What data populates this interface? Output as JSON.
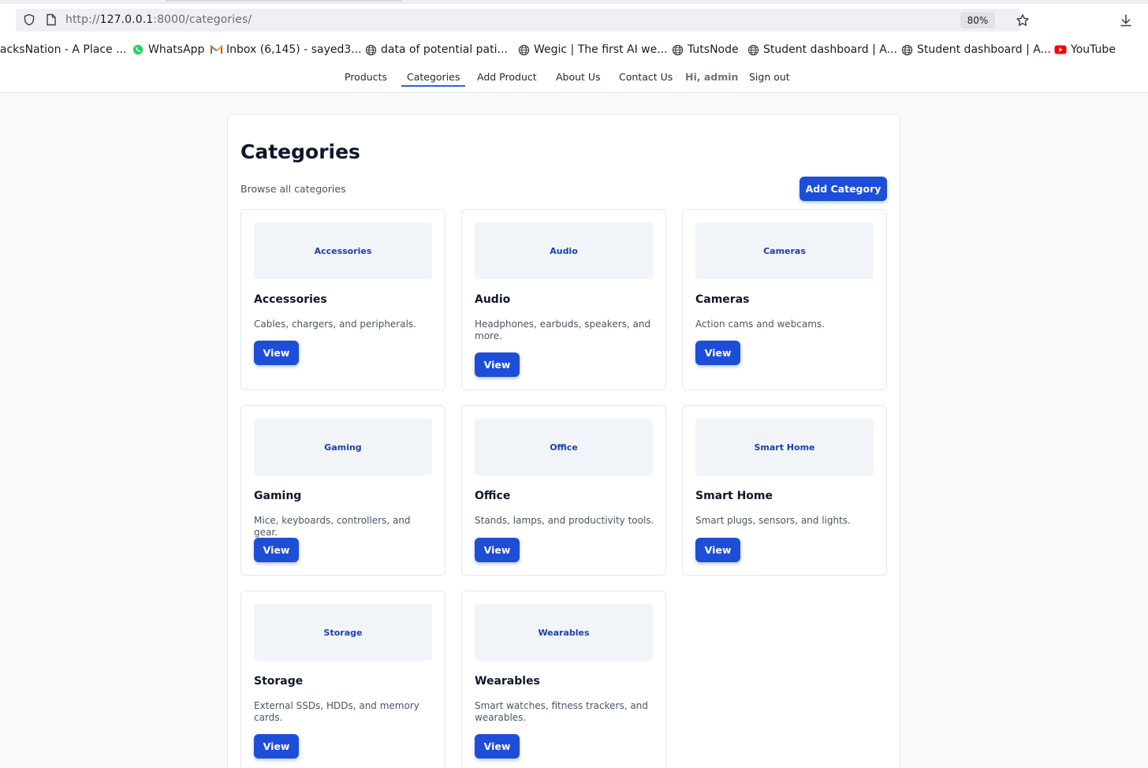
{
  "browser": {
    "url_prefix": "http://",
    "url_host": "127.0.0.1",
    "url_rest": ":8000/categories/",
    "zoom": "80%",
    "bookmarks": [
      {
        "label": "lacksNation - A Place ...",
        "icon": "none"
      },
      {
        "label": "WhatsApp",
        "icon": "whatsapp-icon"
      },
      {
        "label": "Inbox (6,145) - sayed3...",
        "icon": "gmail-icon"
      },
      {
        "label": "data of potential pati...",
        "icon": "globe-icon"
      },
      {
        "label": "Wegic | The first AI we...",
        "icon": "globe-icon"
      },
      {
        "label": "TutsNode",
        "icon": "globe-icon"
      },
      {
        "label": "Student dashboard | A...",
        "icon": "globe-icon"
      },
      {
        "label": "Student dashboard | A...",
        "icon": "globe-icon"
      },
      {
        "label": "YouTube",
        "icon": "youtube-icon"
      }
    ]
  },
  "nav": {
    "links": [
      "Products",
      "Categories",
      "Add Product",
      "About Us",
      "Contact Us"
    ],
    "active": "Categories",
    "greeting": "Hi, admin",
    "signout": "Sign out"
  },
  "page": {
    "title": "Categories",
    "subtitle": "Browse all categories",
    "add_button": "Add Category"
  },
  "categories": [
    {
      "thumb": "Accessories",
      "name": "Accessories",
      "desc": "Cables, chargers, and peripherals.",
      "button": "View"
    },
    {
      "thumb": "Audio",
      "name": "Audio",
      "desc": "Headphones, earbuds, speakers, and more.",
      "button": "View"
    },
    {
      "thumb": "Cameras",
      "name": "Cameras",
      "desc": "Action cams and webcams.",
      "button": "View"
    },
    {
      "thumb": "Gaming",
      "name": "Gaming",
      "desc": "Mice, keyboards, controllers, and gear.",
      "button": "View"
    },
    {
      "thumb": "Office",
      "name": "Office",
      "desc": "Stands, lamps, and productivity tools.",
      "button": "View"
    },
    {
      "thumb": "Smart Home",
      "name": "Smart Home",
      "desc": "Smart plugs, sensors, and lights.",
      "button": "View"
    },
    {
      "thumb": "Storage",
      "name": "Storage",
      "desc": "External SSDs, HDDs, and memory cards.",
      "button": "View"
    },
    {
      "thumb": "Wearables",
      "name": "Wearables",
      "desc": "Smart watches, fitness trackers, and wearables.",
      "button": "View"
    }
  ],
  "colors": {
    "primary": "#1d4ed8",
    "accent_text": "#1e40af",
    "page_bg": "#f8fafc"
  }
}
